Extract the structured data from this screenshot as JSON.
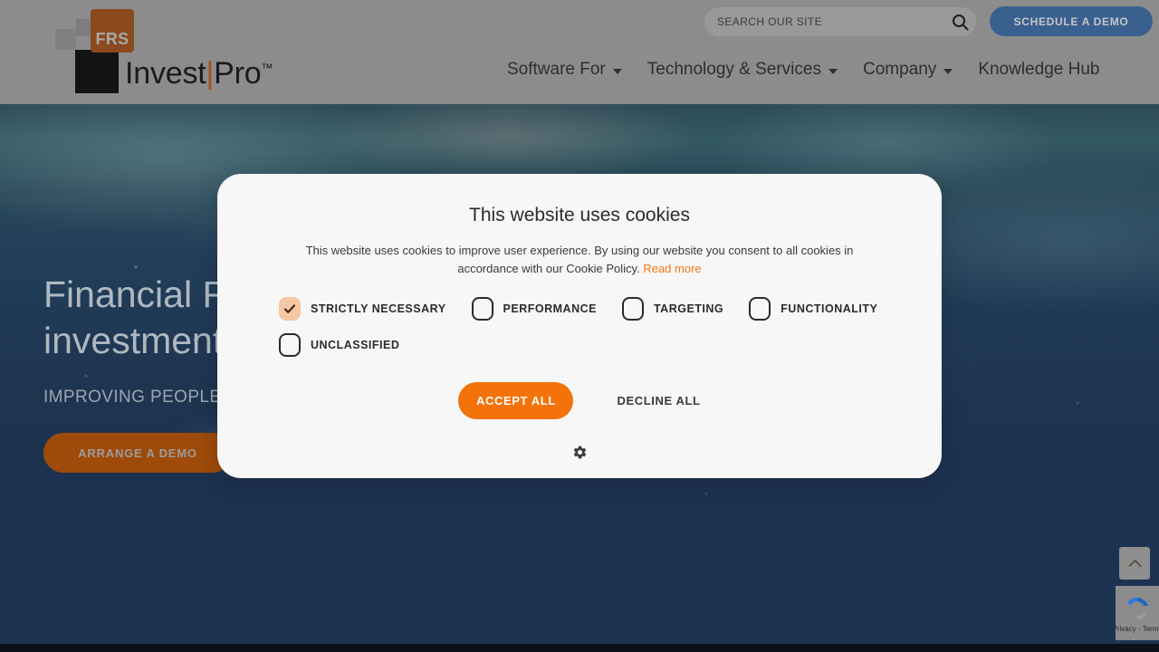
{
  "header": {
    "logo": {
      "badge_text": "FRS",
      "wordmark_primary": "Invest",
      "wordmark_divider": "|",
      "wordmark_secondary": "Pro",
      "trademark": "™"
    },
    "search": {
      "placeholder": "SEARCH OUR SITE",
      "value": "",
      "icon": "search-icon"
    },
    "cta_label": "SCHEDULE A DEMO",
    "nav": [
      {
        "label": "Software For",
        "has_dropdown": true
      },
      {
        "label": "Technology & Services",
        "has_dropdown": true
      },
      {
        "label": "Company",
        "has_dropdown": true
      },
      {
        "label": "Knowledge Hub",
        "has_dropdown": false
      }
    ]
  },
  "hero": {
    "title": "Financial Risk Solutions (FRS) Invest|Pro™ investment administration software",
    "subtitle": "IMPROVING PEOPLE'S RETIREMENT WITH TECHNOLOGY",
    "cta_label": "ARRANGE A DEMO"
  },
  "cookie_dialog": {
    "title": "This website uses cookies",
    "description": "This website uses cookies to improve user experience. By using our website you consent to all cookies in accordance with our Cookie Policy.",
    "read_more_label": "Read more",
    "categories": [
      {
        "label": "STRICTLY NECESSARY",
        "checked": true
      },
      {
        "label": "PERFORMANCE",
        "checked": false
      },
      {
        "label": "TARGETING",
        "checked": false
      },
      {
        "label": "FUNCTIONALITY",
        "checked": false
      },
      {
        "label": "UNCLASSIFIED",
        "checked": false
      }
    ],
    "accept_label": "ACCEPT ALL",
    "decline_label": "DECLINE ALL",
    "settings_icon": "gear-icon"
  },
  "widgets": {
    "scroll_top_icon": "chevron-up-icon",
    "recaptcha_label": "Privacy - Terms"
  },
  "colors": {
    "brand_orange": "#f4720a",
    "logo_orange": "#8a4a1e",
    "link_orange": "#f07818",
    "demo_blue": "#3a6090",
    "checked_box": "#f6c7a5",
    "dialog_bg": "#f7f7f7",
    "page_navy": "#1e3352",
    "header_dimmed": "#8c8c8c"
  }
}
